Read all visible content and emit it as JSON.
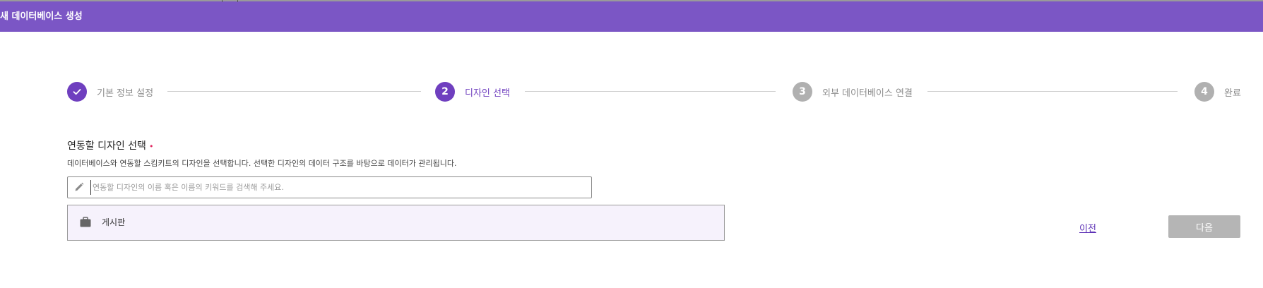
{
  "header": {
    "title": "새 데이터베이스 생성",
    "accent_color": "#7b56c5"
  },
  "stepper": {
    "steps": [
      {
        "marker": "✓",
        "label": "기본 정보 설정",
        "state": "done"
      },
      {
        "marker": "2",
        "label": "디자인 선택",
        "state": "active"
      },
      {
        "marker": "3",
        "label": "외부 데이터베이스 연결",
        "state": "todo"
      },
      {
        "marker": "4",
        "label": "완료",
        "state": "todo"
      }
    ],
    "active_color": "#6f3fbf",
    "inactive_color": "#b0b0b0"
  },
  "design_select": {
    "title": "연동할 디자인 선택",
    "required_mark": "•",
    "description": "데이터베이스와 연동할 스킴키트의 디자인을 선택합니다. 선택한 디자인의 데이터 구조를 바탕으로 데이터가 관리됩니다.",
    "search": {
      "value": "",
      "placeholder": "연동할 디자인의 이름 혹은 이름의 키워드를 검색해 주세요.",
      "icon": "pencil-icon"
    },
    "items": [
      {
        "icon": "briefcase-icon",
        "name": "게시판"
      }
    ]
  },
  "footer": {
    "prev_label": "이전",
    "next_label": "다음"
  }
}
